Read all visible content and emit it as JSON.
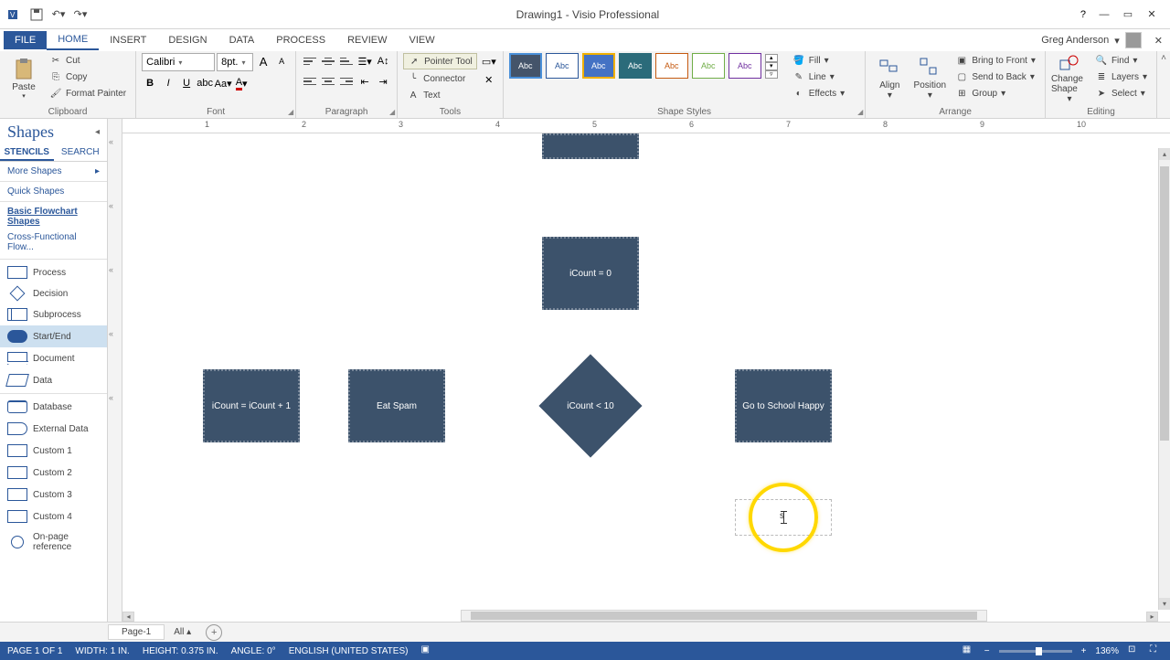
{
  "title": "Drawing1 - Visio Professional",
  "user": "Greg Anderson",
  "tabs": [
    "FILE",
    "HOME",
    "INSERT",
    "DESIGN",
    "DATA",
    "PROCESS",
    "REVIEW",
    "VIEW"
  ],
  "active_tab": 1,
  "ribbon": {
    "clipboard": {
      "paste": "Paste",
      "cut": "Cut",
      "copy": "Copy",
      "painter": "Format Painter",
      "label": "Clipboard"
    },
    "font": {
      "family": "Calibri",
      "size": "8pt.",
      "label": "Font"
    },
    "paragraph": {
      "label": "Paragraph"
    },
    "tools": {
      "pointer": "Pointer Tool",
      "connector": "Connector",
      "text": "Text",
      "label": "Tools"
    },
    "styles": {
      "label": "Shape Styles",
      "fill": "Fill",
      "line": "Line",
      "effects": "Effects"
    },
    "arrange": {
      "align": "Align",
      "position": "Position",
      "front": "Bring to Front",
      "back": "Send to Back",
      "group": "Group",
      "label": "Arrange"
    },
    "editing": {
      "change": "Change Shape",
      "find": "Find",
      "layers": "Layers",
      "select": "Select",
      "label": "Editing"
    }
  },
  "shapes_panel": {
    "title": "Shapes",
    "tabs": [
      "STENCILS",
      "SEARCH"
    ],
    "stencils": [
      "More Shapes",
      "Quick Shapes",
      "Basic Flowchart Shapes",
      "Cross-Functional Flow..."
    ],
    "shapes": [
      "Process",
      "Decision",
      "Subprocess",
      "Start/End",
      "Document",
      "Data",
      "Database",
      "External Data",
      "Custom 1",
      "Custom 2",
      "Custom 3",
      "Custom 4",
      "On-page reference"
    ],
    "selected_shape": "Start/End"
  },
  "canvas_shapes": {
    "top_partial": "",
    "icount_init": "iCount = 0",
    "icount_inc": "iCount = iCount + 1",
    "eat": "Eat Spam",
    "decision": "iCount < 10",
    "school": "Go to School Happy"
  },
  "ruler_nums": [
    "1",
    "2",
    "3",
    "4",
    "5",
    "6",
    "7",
    "8",
    "9",
    "10"
  ],
  "page_tabs": {
    "page": "Page-1",
    "all": "All"
  },
  "status": {
    "page": "PAGE 1 OF 1",
    "width": "WIDTH: 1 IN.",
    "height": "HEIGHT: 0.375 IN.",
    "angle": "ANGLE: 0°",
    "lang": "ENGLISH (UNITED STATES)",
    "zoom": "136%"
  }
}
